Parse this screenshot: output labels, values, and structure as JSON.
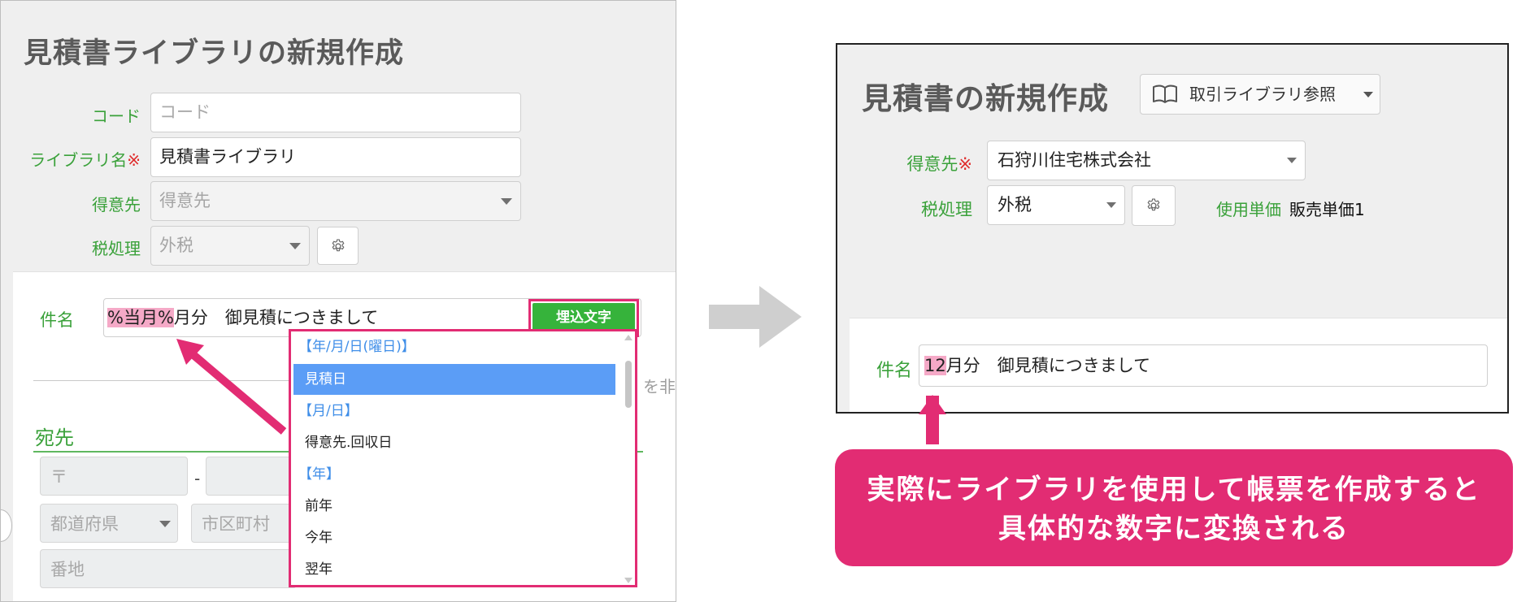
{
  "left_form": {
    "title": "見積書ライブラリの新規作成",
    "code_label": "コード",
    "code_placeholder": "コード",
    "library_name_label": "ライブラリ名",
    "required_mark": "※",
    "library_name_value": "見積書ライブラリ",
    "customer_label": "得意先",
    "customer_placeholder": "得意先",
    "tax_label": "税処理",
    "tax_value": "外税",
    "subject_label": "件名",
    "subject_token": "%当月%",
    "subject_rest": "月分　御見積につきまして",
    "embed_button": "埋込文字",
    "hidden_text": "を非表",
    "destination_section": "宛先",
    "postal_placeholder": "〒",
    "postal_dash": "-",
    "prefecture_placeholder": "都道府県",
    "city_placeholder": "市区町村",
    "address_placeholder": "番地"
  },
  "dropdown": {
    "items": [
      {
        "label": "【年/月/日(曜日)】",
        "kind": "group"
      },
      {
        "label": "見積日",
        "kind": "selected"
      },
      {
        "label": "【月/日】",
        "kind": "group"
      },
      {
        "label": "得意先.回収日",
        "kind": "option"
      },
      {
        "label": "【年】",
        "kind": "group"
      },
      {
        "label": "前年",
        "kind": "option"
      },
      {
        "label": "今年",
        "kind": "option"
      },
      {
        "label": "翌年",
        "kind": "option"
      }
    ]
  },
  "right_form": {
    "title": "見積書の新規作成",
    "library_button": "取引ライブラリ参照",
    "customer_label": "得意先",
    "required_mark": "※",
    "customer_value": "石狩川住宅株式会社",
    "tax_label": "税処理",
    "tax_value": "外税",
    "unit_price_label": "使用単価",
    "unit_price_value": "販売単価1",
    "subject_label": "件名",
    "subject_number": "12",
    "subject_rest": "月分　御見積につきまして"
  },
  "callout": {
    "line1": "実際にライブラリを使用して帳票を作成すると",
    "line2": "具体的な数字に変換される"
  },
  "colors": {
    "accent_pink": "#e22c73",
    "label_green": "#3aa13a",
    "highlight_pink": "#f5a9c7",
    "embed_green": "#36b33b",
    "selected_blue": "#5b9df6",
    "group_blue": "#3f8ee8"
  },
  "icons": [
    "gear-icon",
    "book-icon",
    "chevron-down-icon",
    "right-arrow-icon"
  ]
}
